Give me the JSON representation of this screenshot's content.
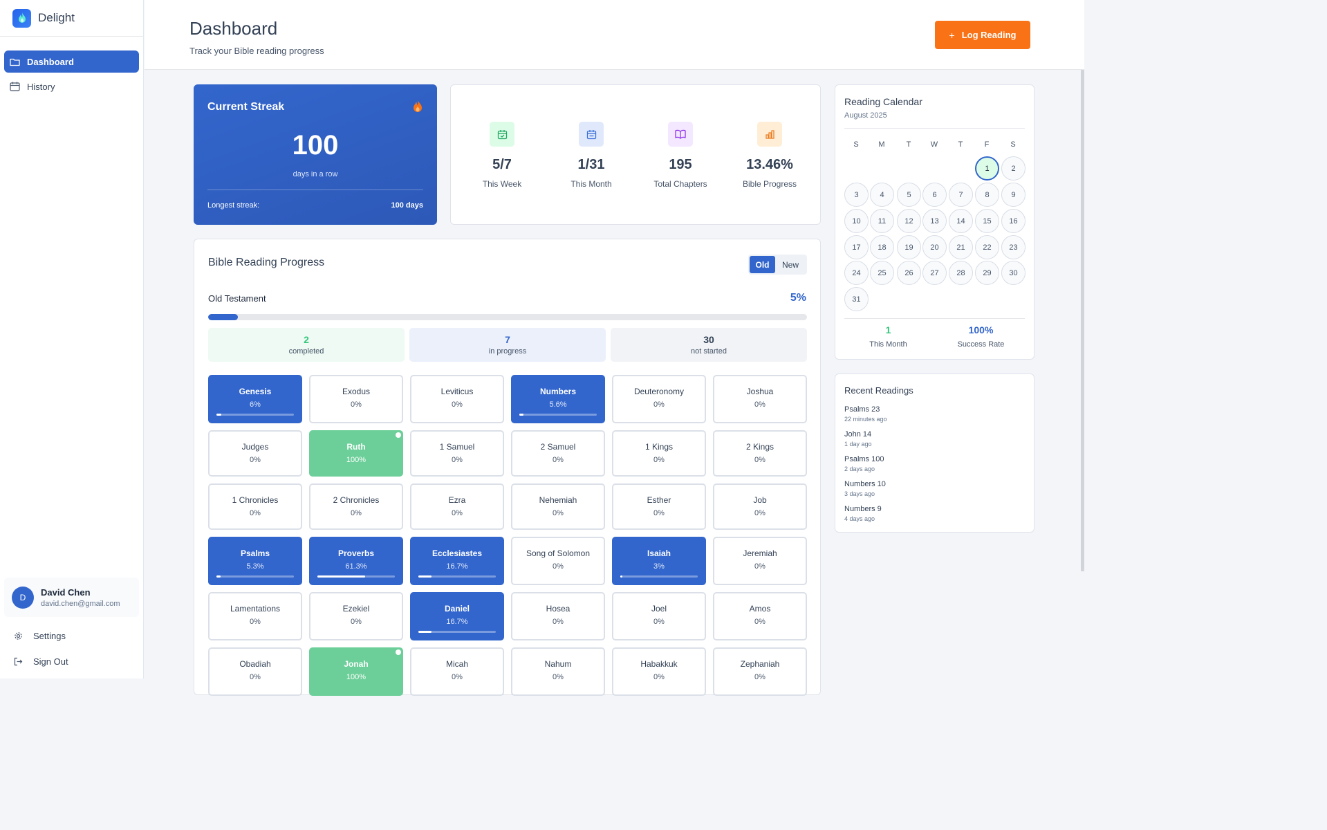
{
  "app": {
    "name": "Delight"
  },
  "nav": {
    "items": [
      {
        "label": "Dashboard",
        "active": true
      },
      {
        "label": "History",
        "active": false
      }
    ]
  },
  "user": {
    "initial": "D",
    "name": "David Chen",
    "email": "david.chen@gmail.com"
  },
  "sidebar_links": {
    "settings": "Settings",
    "signout": "Sign Out"
  },
  "header": {
    "title": "Dashboard",
    "subtitle": "Track your Bible reading progress",
    "log_button": "Log Reading"
  },
  "streak": {
    "title": "Current Streak",
    "value": "100",
    "unit": "days in a row",
    "longest_label": "Longest streak:",
    "longest_value": "100 days"
  },
  "stats": [
    {
      "value": "5/7",
      "label": "This Week",
      "icon": "calendar-check-icon",
      "color": "#22a861",
      "bg": "#dcfce7"
    },
    {
      "value": "1/31",
      "label": "This Month",
      "icon": "calendar-icon",
      "color": "#3b6fd8",
      "bg": "#e0e9fb"
    },
    {
      "value": "195",
      "label": "Total Chapters",
      "icon": "book-open-icon",
      "color": "#9333ea",
      "bg": "#f3e8ff"
    },
    {
      "value": "13.46%",
      "label": "Bible Progress",
      "icon": "bar-chart-icon",
      "color": "#ea7a1e",
      "bg": "#ffedd5"
    }
  ],
  "progress": {
    "title": "Bible Reading Progress",
    "toggle": {
      "old": "Old",
      "new": "New",
      "selected": "Old"
    },
    "testament_label": "Old Testament",
    "testament_pct": "5%",
    "testament_fraction": 0.05,
    "counts": [
      {
        "value": "2",
        "label": "completed",
        "color": "#34c77b",
        "bg": "#eefaf3"
      },
      {
        "value": "7",
        "label": "in progress",
        "color": "#3366cc",
        "bg": "#ebf0fb"
      },
      {
        "value": "30",
        "label": "not started",
        "color": "#334155",
        "bg": "#f1f3f6"
      }
    ],
    "books": [
      {
        "name": "Genesis",
        "pct": "6%",
        "fraction": 0.06,
        "status": "in-progress"
      },
      {
        "name": "Exodus",
        "pct": "0%",
        "fraction": 0,
        "status": "not-started"
      },
      {
        "name": "Leviticus",
        "pct": "0%",
        "fraction": 0,
        "status": "not-started"
      },
      {
        "name": "Numbers",
        "pct": "5.6%",
        "fraction": 0.056,
        "status": "in-progress"
      },
      {
        "name": "Deuteronomy",
        "pct": "0%",
        "fraction": 0,
        "status": "not-started"
      },
      {
        "name": "Joshua",
        "pct": "0%",
        "fraction": 0,
        "status": "not-started"
      },
      {
        "name": "Judges",
        "pct": "0%",
        "fraction": 0,
        "status": "not-started"
      },
      {
        "name": "Ruth",
        "pct": "100%",
        "fraction": 1,
        "status": "completed"
      },
      {
        "name": "1 Samuel",
        "pct": "0%",
        "fraction": 0,
        "status": "not-started"
      },
      {
        "name": "2 Samuel",
        "pct": "0%",
        "fraction": 0,
        "status": "not-started"
      },
      {
        "name": "1 Kings",
        "pct": "0%",
        "fraction": 0,
        "status": "not-started"
      },
      {
        "name": "2 Kings",
        "pct": "0%",
        "fraction": 0,
        "status": "not-started"
      },
      {
        "name": "1 Chronicles",
        "pct": "0%",
        "fraction": 0,
        "status": "not-started"
      },
      {
        "name": "2 Chronicles",
        "pct": "0%",
        "fraction": 0,
        "status": "not-started"
      },
      {
        "name": "Ezra",
        "pct": "0%",
        "fraction": 0,
        "status": "not-started"
      },
      {
        "name": "Nehemiah",
        "pct": "0%",
        "fraction": 0,
        "status": "not-started"
      },
      {
        "name": "Esther",
        "pct": "0%",
        "fraction": 0,
        "status": "not-started"
      },
      {
        "name": "Job",
        "pct": "0%",
        "fraction": 0,
        "status": "not-started"
      },
      {
        "name": "Psalms",
        "pct": "5.3%",
        "fraction": 0.053,
        "status": "in-progress"
      },
      {
        "name": "Proverbs",
        "pct": "61.3%",
        "fraction": 0.613,
        "status": "in-progress"
      },
      {
        "name": "Ecclesiastes",
        "pct": "16.7%",
        "fraction": 0.167,
        "status": "in-progress"
      },
      {
        "name": "Song of Solomon",
        "pct": "0%",
        "fraction": 0,
        "status": "not-started"
      },
      {
        "name": "Isaiah",
        "pct": "3%",
        "fraction": 0.03,
        "status": "in-progress"
      },
      {
        "name": "Jeremiah",
        "pct": "0%",
        "fraction": 0,
        "status": "not-started"
      },
      {
        "name": "Lamentations",
        "pct": "0%",
        "fraction": 0,
        "status": "not-started"
      },
      {
        "name": "Ezekiel",
        "pct": "0%",
        "fraction": 0,
        "status": "not-started"
      },
      {
        "name": "Daniel",
        "pct": "16.7%",
        "fraction": 0.167,
        "status": "in-progress"
      },
      {
        "name": "Hosea",
        "pct": "0%",
        "fraction": 0,
        "status": "not-started"
      },
      {
        "name": "Joel",
        "pct": "0%",
        "fraction": 0,
        "status": "not-started"
      },
      {
        "name": "Amos",
        "pct": "0%",
        "fraction": 0,
        "status": "not-started"
      },
      {
        "name": "Obadiah",
        "pct": "0%",
        "fraction": 0,
        "status": "not-started"
      },
      {
        "name": "Jonah",
        "pct": "100%",
        "fraction": 1,
        "status": "completed"
      },
      {
        "name": "Micah",
        "pct": "0%",
        "fraction": 0,
        "status": "not-started"
      },
      {
        "name": "Nahum",
        "pct": "0%",
        "fraction": 0,
        "status": "not-started"
      },
      {
        "name": "Habakkuk",
        "pct": "0%",
        "fraction": 0,
        "status": "not-started"
      },
      {
        "name": "Zephaniah",
        "pct": "0%",
        "fraction": 0,
        "status": "not-started"
      }
    ]
  },
  "calendar": {
    "title": "Reading Calendar",
    "month": "August 2025",
    "weekdays": [
      "S",
      "M",
      "T",
      "W",
      "T",
      "F",
      "S"
    ],
    "first_weekday": 5,
    "days": 31,
    "today": 1,
    "stats": [
      {
        "value": "1",
        "label": "This Month",
        "color": "#34c77b"
      },
      {
        "value": "100%",
        "label": "Success Rate",
        "color": "#3366cc"
      }
    ]
  },
  "recent": {
    "title": "Recent Readings",
    "items": [
      {
        "name": "Psalms 23",
        "time": "22 minutes ago"
      },
      {
        "name": "John 14",
        "time": "1 day ago"
      },
      {
        "name": "Psalms 100",
        "time": "2 days ago"
      },
      {
        "name": "Numbers 10",
        "time": "3 days ago"
      },
      {
        "name": "Numbers 9",
        "time": "4 days ago"
      }
    ]
  }
}
